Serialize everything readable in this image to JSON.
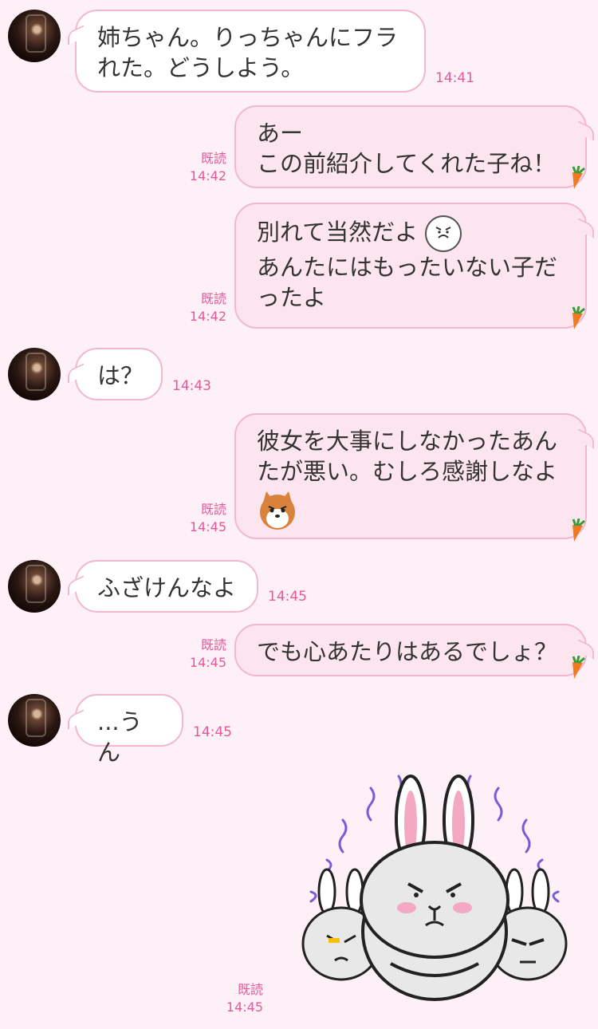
{
  "messages": [
    {
      "text": "姉ちゃん。りっちゃんにフラれた。どうしよう。",
      "time": "14:41"
    },
    {
      "text": "あー\nこの前紹介してくれた子ね！",
      "read": "既読",
      "time": "14:42"
    },
    {
      "text_a": "別れて当然だよ",
      "text_b": "あんたにはもったいない子だったよ",
      "read": "既読",
      "time": "14:42"
    },
    {
      "text": "は？",
      "time": "14:43"
    },
    {
      "text": "彼女を大事にしなかったあんたが悪い。むしろ感謝しなよ",
      "read": "既読",
      "time": "14:45"
    },
    {
      "text": "ふざけんなよ",
      "time": "14:45"
    },
    {
      "text": "でも心あたりはあるでしょ？",
      "read": "既読",
      "time": "14:45"
    },
    {
      "text": "...うん",
      "time": "14:45"
    },
    {
      "read": "既読",
      "time": "14:45"
    }
  ],
  "icons": {
    "avatar": "friend-avatar",
    "carrot": "carrot-icon",
    "angry_face": "angry-face-emoji",
    "shiba": "shiba-dog-emoji",
    "sticker": "angry-bunnies-sticker"
  },
  "colors": {
    "background": "#fdf0f6",
    "bubble_border": "#f2b6d1",
    "outgoing_bubble": "#fde5ef",
    "timestamp": "#e35a99"
  }
}
